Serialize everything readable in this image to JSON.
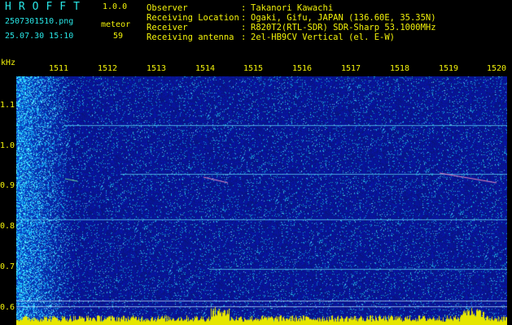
{
  "header": {
    "brand": "HROFFT",
    "version": "1.0.0",
    "filename": "2507301510.png",
    "meteor_label": "meteor",
    "datetime": "25.07.30 15:10",
    "meteor_count": "59"
  },
  "info": [
    {
      "key": "Observer",
      "value": "Takanori Kawachi"
    },
    {
      "key": "Receiving Location",
      "value": "Ogaki, Gifu, JAPAN (136.60E, 35.35N)"
    },
    {
      "key": "Receiver",
      "value": "R820T2(RTL-SDR) SDR-Sharp 53.1000MHz"
    },
    {
      "key": "Receiving antenna",
      "value": "2el-HB9CV Vertical (el. E-W)"
    }
  ],
  "separator": ":",
  "axis": {
    "unit": "kHz",
    "y_ticks": [
      "1.1",
      "1.0",
      "0.9",
      "0.8",
      "0.7",
      "0.6"
    ],
    "x_ticks": [
      "1511",
      "1512",
      "1513",
      "1514",
      "1515",
      "1516",
      "1517",
      "1518",
      "1519",
      "1520"
    ]
  },
  "colors": {
    "label_yellow": "#f2f20a",
    "label_cyan": "#29e6e6",
    "background": "#000000",
    "spectrum_base": "#0a1a8c"
  }
}
